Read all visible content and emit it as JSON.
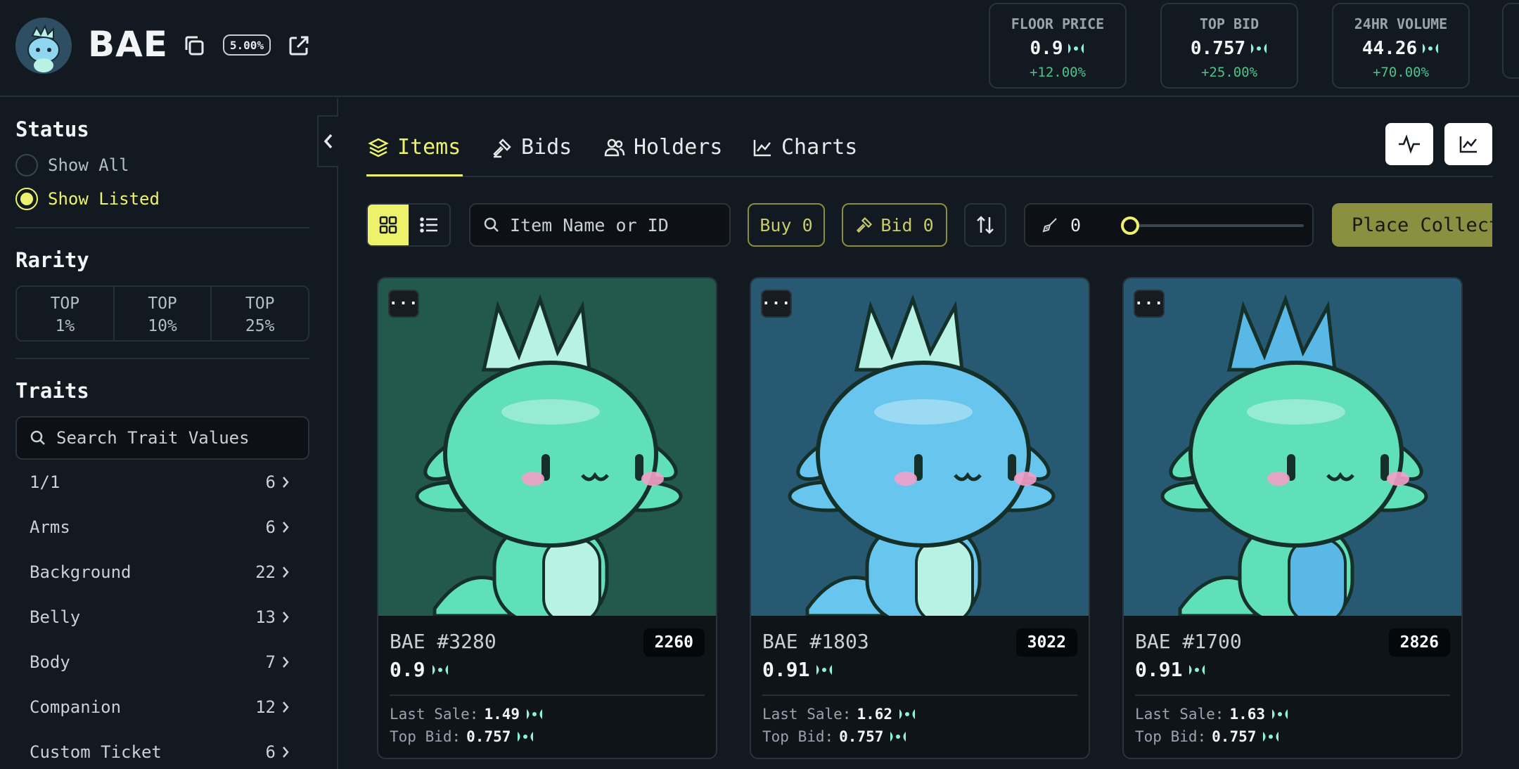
{
  "collection": {
    "name": "BAE",
    "fee_badge": "5.00%"
  },
  "stats": [
    {
      "label": "FLOOR PRICE",
      "value": "0.9",
      "change": "+12.00%"
    },
    {
      "label": "TOP BID",
      "value": "0.757",
      "change": "+25.00%"
    },
    {
      "label": "24HR VOLUME",
      "value": "44.26",
      "change": "+70.00%"
    }
  ],
  "sidebar": {
    "status": {
      "title": "Status",
      "options": [
        {
          "label": "Show All",
          "selected": false
        },
        {
          "label": "Show Listed",
          "selected": true
        }
      ]
    },
    "rarity": {
      "title": "Rarity",
      "buttons": [
        {
          "top": "TOP",
          "pct": "1%"
        },
        {
          "top": "TOP",
          "pct": "10%"
        },
        {
          "top": "TOP",
          "pct": "25%"
        }
      ]
    },
    "traits": {
      "title": "Traits",
      "search_placeholder": "Search Trait Values",
      "items": [
        {
          "label": "1/1",
          "count": "6"
        },
        {
          "label": "Arms",
          "count": "6"
        },
        {
          "label": "Background",
          "count": "22"
        },
        {
          "label": "Belly",
          "count": "13"
        },
        {
          "label": "Body",
          "count": "7"
        },
        {
          "label": "Companion",
          "count": "12"
        },
        {
          "label": "Custom Ticket",
          "count": "6"
        }
      ]
    }
  },
  "tabs": [
    {
      "label": "Items",
      "icon": "layers-icon",
      "active": true
    },
    {
      "label": "Bids",
      "icon": "gavel-icon",
      "active": false
    },
    {
      "label": "Holders",
      "icon": "users-icon",
      "active": false
    },
    {
      "label": "Charts",
      "icon": "chart-icon",
      "active": false
    }
  ],
  "toolbar": {
    "search_placeholder": "Item Name or ID",
    "buy_label": "Buy 0",
    "bid_label": "Bid 0",
    "sweep_value": "0",
    "sweep_fraction": 0,
    "place_label": "Place Collection Bid"
  },
  "cards": [
    {
      "name": "BAE #3280",
      "rank": "2260",
      "price": "0.9",
      "last_sale_label": "Last Sale:",
      "last_sale": "1.49",
      "top_bid_label": "Top Bid:",
      "top_bid": "0.757",
      "bg": "#23584d",
      "body": "#5fe0b8",
      "crest": "#b8f2e4"
    },
    {
      "name": "BAE #1803",
      "rank": "3022",
      "price": "0.91",
      "last_sale_label": "Last Sale:",
      "last_sale": "1.62",
      "top_bid_label": "Top Bid:",
      "top_bid": "0.757",
      "bg": "#275a72",
      "body": "#68c6ee",
      "crest": "#b8f2e4"
    },
    {
      "name": "BAE #1700",
      "rank": "2826",
      "price": "0.91",
      "last_sale_label": "Last Sale:",
      "last_sale": "1.63",
      "top_bid_label": "Top Bid:",
      "top_bid": "0.757",
      "bg": "#275a72",
      "body": "#5fe0b8",
      "crest": "#5ab8e6"
    }
  ],
  "colors": {
    "accent": "#eef26b",
    "positive": "#4cc38a",
    "sui_token": "#8ff0dc"
  }
}
